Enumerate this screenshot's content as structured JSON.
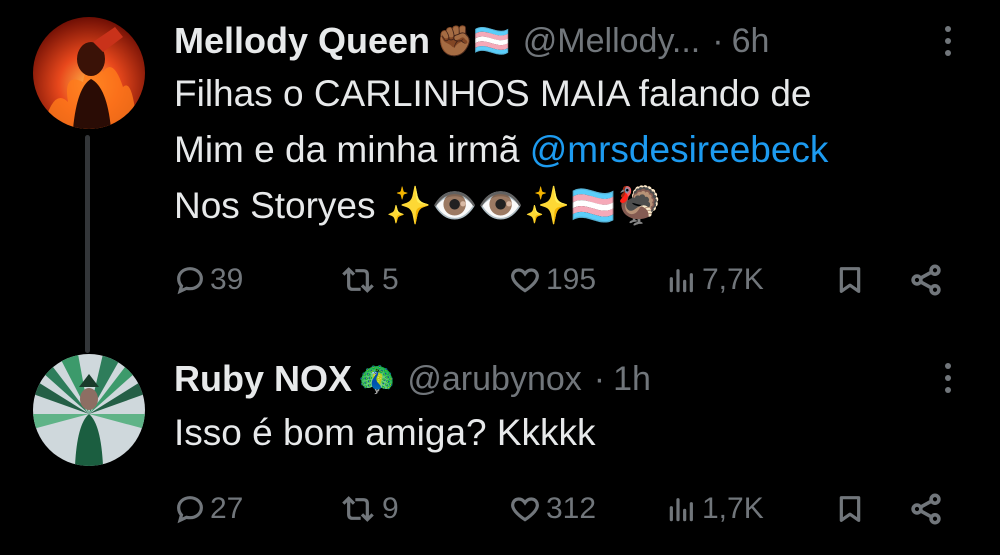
{
  "tweets": [
    {
      "name": "Mellody Queen",
      "name_emoji": "✊🏾🏳️‍⚧️",
      "handle": "@Mellody...",
      "separator": "·",
      "time": "6h",
      "text_line1": "Filhas o CARLINHOS MAIA falando de",
      "text_line2_prefix": "Mim e da minha irmã ",
      "mention": "@mrsdesireebeck",
      "text_line3": "Nos Storyes ✨👁️👁️✨🏳️‍⚧️🦃",
      "replies": "39",
      "retweets": "5",
      "likes": "195",
      "views": "7,7K"
    },
    {
      "name": "Ruby NOX",
      "name_emoji": "🦚",
      "handle": "@arubynox",
      "separator": "·",
      "time": "1h",
      "text_line1": "Isso é bom amiga? Kkkkk",
      "replies": "27",
      "retweets": "9",
      "likes": "312",
      "views": "1,7K"
    }
  ],
  "icons": {
    "reply": "reply-icon",
    "retweet": "retweet-icon",
    "like": "heart-icon",
    "views": "views-icon",
    "bookmark": "bookmark-icon",
    "share": "share-icon",
    "more": "more-icon"
  },
  "colors": {
    "background": "#000000",
    "text": "#e7e9ea",
    "muted": "#71767b",
    "mention": "#1d9bf0",
    "thread_line": "#333639"
  }
}
